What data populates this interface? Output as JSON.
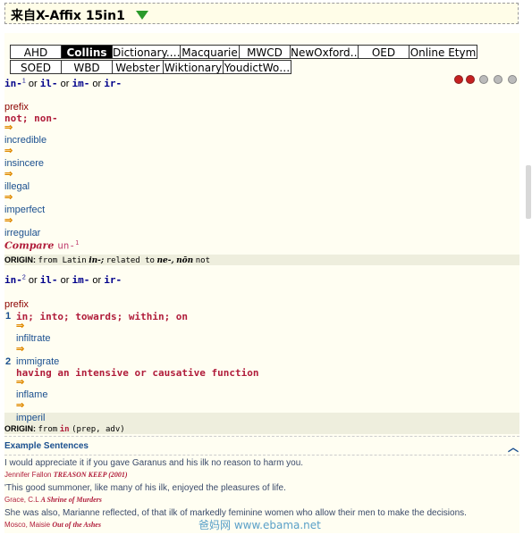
{
  "header": {
    "title": "来自X-Affix 15in1"
  },
  "tabs_row1": [
    {
      "label": "AHD",
      "active": false
    },
    {
      "label": "Collins",
      "active": true
    },
    {
      "label": "Dictionary.…",
      "active": false
    },
    {
      "label": "Macquarie",
      "active": false
    },
    {
      "label": "MWCD",
      "active": false
    },
    {
      "label": "NewOxford…",
      "active": false
    },
    {
      "label": "OED",
      "active": false
    },
    {
      "label": "Online Etym",
      "active": false
    }
  ],
  "tabs_row2": [
    {
      "label": "SOED",
      "active": false
    },
    {
      "label": "WBD",
      "active": false
    },
    {
      "label": "Webster",
      "active": false
    },
    {
      "label": "Wiktionary",
      "active": false
    },
    {
      "label": "YoudictWo…",
      "active": false
    }
  ],
  "entry1": {
    "hw1": "in-",
    "sup": "1",
    "or1": "or",
    "hw2": "il-",
    "or2": "or",
    "hw3": "im-",
    "or3": "or",
    "hw4": "ir-",
    "pos": "prefix",
    "def": "not; non-",
    "arrow": "⇒",
    "examples": [
      "incredible",
      "insincere",
      "illegal",
      "imperfect",
      "irregular"
    ],
    "compare_label": "Compare",
    "compare_link": "un-",
    "compare_sup": "1",
    "origin_label": "ORIGIN:",
    "origin_text": "from Latin",
    "origin_w1": "in-;",
    "origin_text2": "related to",
    "origin_w2": "ne-,",
    "origin_w3": "nōn",
    "origin_text3": "not"
  },
  "entry2": {
    "hw1": "in-",
    "sup": "2",
    "or1": "or",
    "hw2": "il-",
    "or2": "or",
    "hw3": "im-",
    "or3": "or",
    "hw4": "ir-",
    "pos": "prefix",
    "sense1_no": "1",
    "sense1_def": "in; into; towards; within; on",
    "sense1_examples": [
      "infiltrate",
      "immigrate"
    ],
    "sense2_no": "2",
    "sense2_def": "having an intensive or causative function",
    "sense2_examples": [
      "inflame",
      "imperil"
    ],
    "arrow": "⇒",
    "origin_label": "ORIGIN:",
    "origin_text": "from",
    "origin_w1": "in",
    "origin_text2": "(prep, adv)"
  },
  "examples_section": {
    "title": "Example Sentences",
    "chevron": "︿",
    "items": [
      {
        "sentence": "I would appreciate it if you gave Garanus and his ilk no reason to harm you.",
        "author": "Jennifer Fallon",
        "book": "TREASON KEEP (2001)"
      },
      {
        "sentence": "'This good summoner, like many of his ilk, enjoyed the pleasures of life.",
        "author": "Grace, C.L",
        "book": "A Shrine of Murders"
      },
      {
        "sentence": "She was also, Marianne reflected, of that ilk of markedly feminine women who allow their men to make the decisions.",
        "author": "Mosco, Maisie",
        "book": "Out of the Ashes"
      }
    ]
  },
  "watermark": "爸妈网 www.ebama.net",
  "colors": {
    "accent": "#1a4f8f",
    "definition": "#b01c3a",
    "arrow": "#e08a00",
    "header_bg": "#fffde8"
  }
}
